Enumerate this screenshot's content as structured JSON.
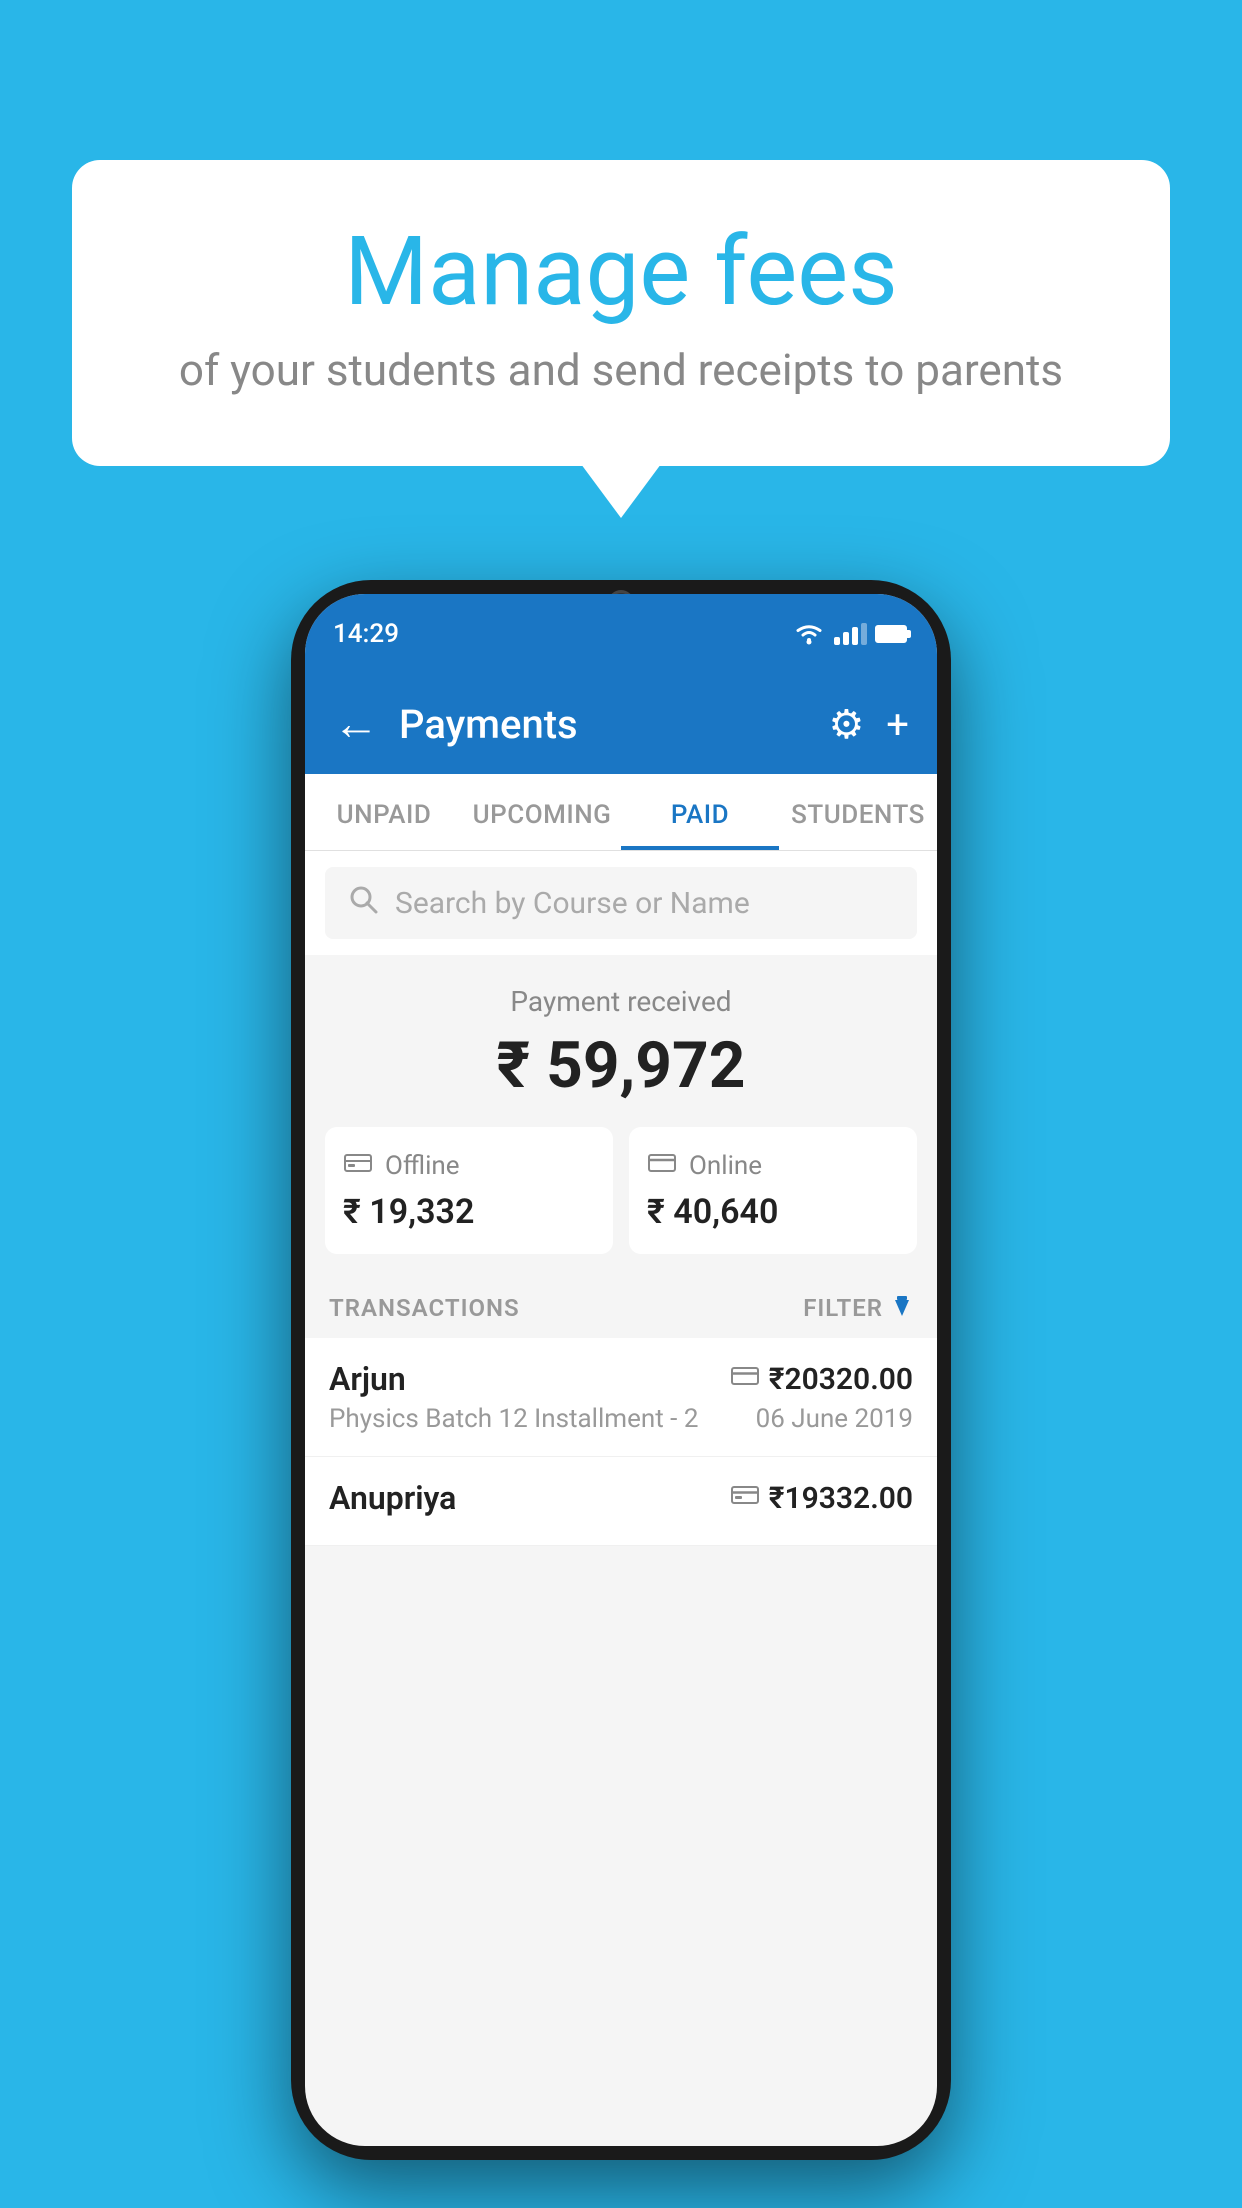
{
  "background_color": "#29B6E8",
  "bubble": {
    "title": "Manage fees",
    "subtitle": "of your students and send receipts to parents"
  },
  "phone": {
    "status_bar": {
      "time": "14:29"
    },
    "header": {
      "back_icon": "←",
      "title": "Payments",
      "settings_icon": "⚙",
      "add_icon": "+"
    },
    "tabs": [
      {
        "label": "UNPAID",
        "active": false
      },
      {
        "label": "UPCOMING",
        "active": false
      },
      {
        "label": "PAID",
        "active": true
      },
      {
        "label": "STUDENTS",
        "active": false
      }
    ],
    "search": {
      "placeholder": "Search by Course or Name"
    },
    "payment_summary": {
      "label": "Payment received",
      "total": "₹ 59,972",
      "offline": {
        "icon": "💳",
        "label": "Offline",
        "amount": "₹ 19,332"
      },
      "online": {
        "icon": "💳",
        "label": "Online",
        "amount": "₹ 40,640"
      }
    },
    "transactions": {
      "section_label": "TRANSACTIONS",
      "filter_label": "FILTER",
      "rows": [
        {
          "name": "Arjun",
          "course": "Physics Batch 12 Installment - 2",
          "amount": "₹20320.00",
          "date": "06 June 2019",
          "payment_type": "online"
        },
        {
          "name": "Anupriya",
          "course": "",
          "amount": "₹19332.00",
          "date": "",
          "payment_type": "offline"
        }
      ]
    }
  }
}
